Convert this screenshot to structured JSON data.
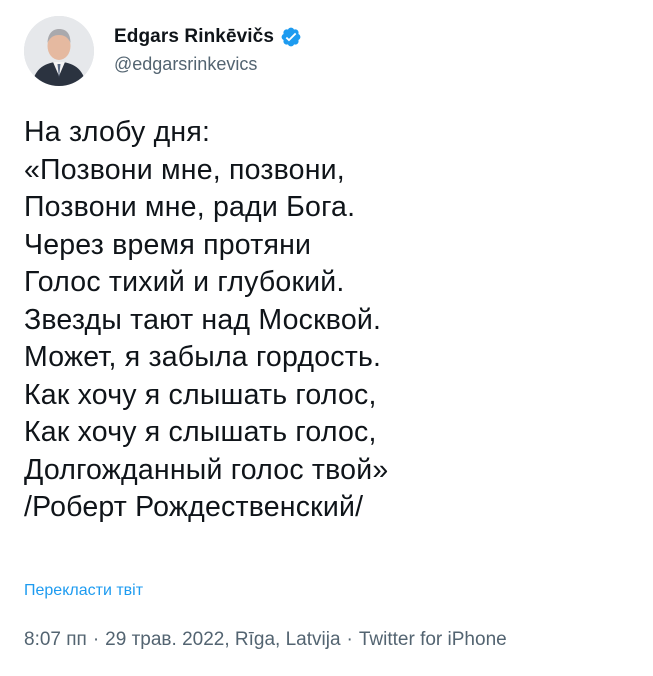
{
  "author": {
    "display_name": "Edgars Rinkēvičs",
    "handle": "@edgarsrinkevics",
    "verified_icon": "verified-badge-icon",
    "verified_color": "#1d9bf0"
  },
  "tweet": {
    "lines": [
      "На злобу дня:",
      "«Позвони мне, позвони,",
      "Позвони мне, ради Бога.",
      "Через время протяни",
      "Голос тихий и глубокий.",
      "Звезды тают над Москвой.",
      "Может, я забыла гордость.",
      "Как хочу я слышать голос,",
      "Как хочу я слышать голос,",
      "Долгожданный голос твой»",
      "/Роберт Рождественский/"
    ],
    "translate_label": "Перекласти твіт"
  },
  "meta": {
    "time": "8:07 пп",
    "date": "29 трав. 2022",
    "location": "Rīga, Latvija",
    "source": "Twitter for iPhone",
    "separator": "·"
  },
  "colors": {
    "text": "#0f1419",
    "secondary": "#536471",
    "link": "#1d9bf0"
  }
}
